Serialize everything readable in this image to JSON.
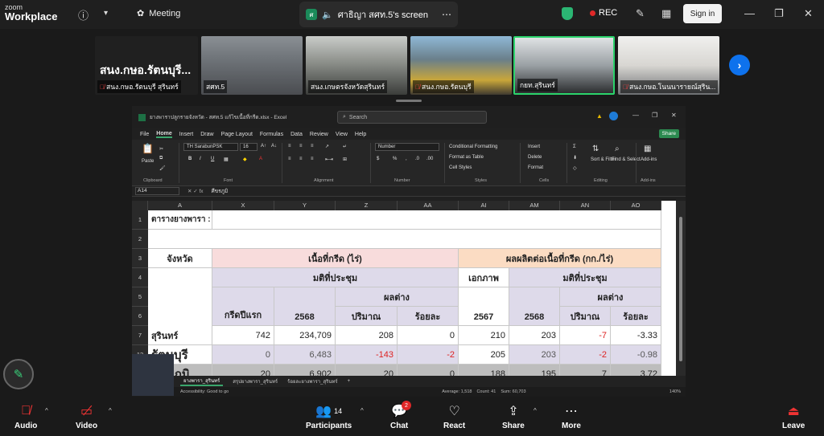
{
  "app": {
    "brand_line1": "zoom",
    "brand_line2": "Workplace",
    "meeting_label": "Meeting",
    "share_label": "ศาธิญา สศท.5's screen",
    "rec_label": "REC",
    "signin_label": "Sign in"
  },
  "gallery": {
    "pinned_name": "สนง.กษอ.รัตนบุรี...",
    "tiles": [
      {
        "label": "สนง.กษอ.รัตนบุรี สุรินทร์"
      },
      {
        "label": "สศท.5"
      },
      {
        "label": "สนง.เกษตรจังหวัดสุรินทร์"
      },
      {
        "label": "สนง.กษอ.รัตนบุรี"
      },
      {
        "label": "กยท.สุรินทร์"
      },
      {
        "label": "สนง.กษอ.โนนนารายณ์สุริน..."
      }
    ]
  },
  "excel": {
    "title": "ยางพาราปลูกรายจังหวัด - สศท.5 แก้ไขเนื้อที่กรีด.xlsx - Excel",
    "search_placeholder": "Search",
    "share_btn": "Share",
    "tabs": [
      "File",
      "Home",
      "Insert",
      "Draw",
      "Page Layout",
      "Formulas",
      "Data",
      "Review",
      "View",
      "Help"
    ],
    "ribbon": {
      "paste": "Paste",
      "font_name": "TH SarabunPSK",
      "font_size": "16",
      "number_format": "Number",
      "cond_fmt": "Conditional Formatting",
      "fmt_table": "Format as Table",
      "cell_styles": "Cell Styles",
      "insert": "Insert",
      "delete": "Delete",
      "format": "Format",
      "sort": "Sort & Filter",
      "find": "Find & Select",
      "addins": "Add-ins",
      "groups": [
        "Clipboard",
        "Font",
        "Alignment",
        "Number",
        "Styles",
        "Cells",
        "Editing",
        "Add-ins"
      ]
    },
    "name_box": "A14",
    "formula_value": "ศีขรภูมิ",
    "columns": [
      "A",
      "X",
      "Y",
      "Z",
      "AA",
      "AI",
      "AM",
      "AN",
      "AO"
    ],
    "rows": [
      "1",
      "2",
      "3",
      "4",
      "5",
      "6",
      "7",
      "12",
      "13"
    ],
    "cells": {
      "r1a": "ตารางยางพารา :",
      "province": "จังหวัด",
      "area_header": "เนื้อที่กรีด (ไร่)",
      "yield_header": "ผลผลิตต่อเนื้อที่กรีด (กก./ไร่)",
      "meeting_res": "มติที่ประชุม",
      "meeting_res2": "มติที่ประชุม",
      "private": "เอกภาพ",
      "diff": "ผลต่าง",
      "diff2": "ผลต่าง",
      "first_tap": "กรีดปีแรก",
      "y2568": "2568",
      "qty": "ปริมาณ",
      "pct": "ร้อยละ",
      "y2567": "2567",
      "y2568b": "2568",
      "qty2": "ปริมาณ",
      "pct2": "ร้อยละ"
    },
    "data_rows": [
      {
        "name": "สุรินทร์",
        "x": "742",
        "y": "234,709",
        "z": "208",
        "aa": "0",
        "ai": "210",
        "am": "203",
        "an": "-7",
        "ao": "-3.33"
      },
      {
        "name": "รัตนบุรี",
        "x": "0",
        "y": "6,483",
        "z": "-143",
        "aa": "-2",
        "ai": "205",
        "am": "203",
        "an": "-2",
        "ao": "-0.98"
      },
      {
        "name": "ศีขรภูมิ",
        "x": "20",
        "y": "6,902",
        "z": "20",
        "aa": "0",
        "ai": "188",
        "am": "195",
        "an": "7",
        "ao": "3.72"
      }
    ],
    "sheet_tabs": [
      "ยางพารา_สุรินทร์",
      "สรุปยางพารา_สุรินทร์",
      "ร้อยละยางพารา_สุรินทร์"
    ],
    "status": {
      "accessibility": "Accessibility: Good to go",
      "average": "Average: 1,518",
      "count": "Count: 41",
      "sum": "Sum: 60,703",
      "zoom": "140%"
    }
  },
  "toolbar": {
    "audio": "Audio",
    "video": "Video",
    "participants": "Participants",
    "participants_count": "14",
    "chat": "Chat",
    "chat_badge": "2",
    "react": "React",
    "share": "Share",
    "more": "More",
    "leave": "Leave"
  }
}
